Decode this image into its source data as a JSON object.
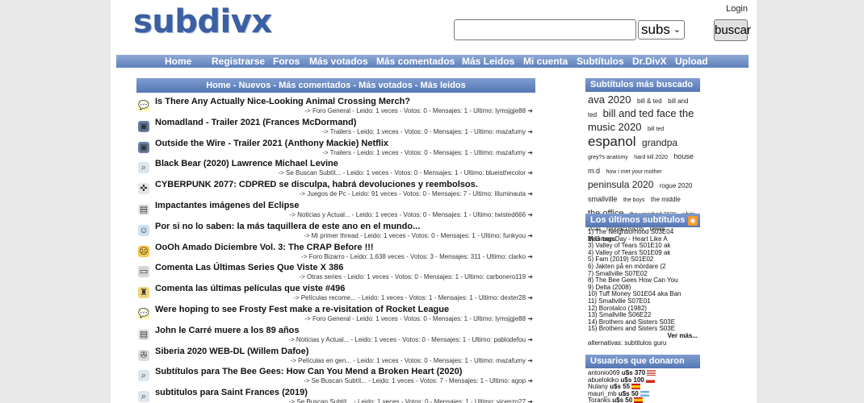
{
  "header": {
    "logo": "subdivx",
    "login": "Login",
    "subs_select": "subs",
    "search_button": "buscar"
  },
  "nav": [
    "Home",
    "Registrarse",
    "Foros",
    "Más votados",
    "Más comentados",
    "Más Leidos",
    "Mi cuenta",
    "Subtítulos",
    "Dr.DivX",
    "Upload"
  ],
  "main": {
    "heading": "Home - Nuevos - Más comentados - Más votados - Más leidos",
    "rows": [
      {
        "icon": "speech-bubble-icon",
        "title": "Is There Any Actually Nice-Looking Animal Crossing Merch?",
        "meta": "-> Foro General - Leido: 1 veces - Votos: 0 - Mensajes: 1 - Ultimo: lymsjgje88"
      },
      {
        "icon": "floppy-disk-icon",
        "title": "Nomadland - Trailer 2021 (Frances McDormand)",
        "meta": "-> Trailers - Leido: 1 veces - Votos: 0 - Mensajes: 1 - Ultimo: mazafumy"
      },
      {
        "icon": "floppy-disk-icon",
        "title": "Outside the Wire - Trailer 2021 (Anthony Mackie) Netflix",
        "meta": "-> Trailers - Leido: 1 veces - Votos: 0 - Mensajes: 1 - Ultimo: mazafumy"
      },
      {
        "icon": "magnifier-icon",
        "title": "Black Bear (2020) Lawrence Michael Levine",
        "meta": "-> Se Buscan Subtít... - Leido: 1 veces - Votos: 0 - Mensajes: 1 - Ultimo: blueisthecolor"
      },
      {
        "icon": "joystick-icon",
        "title": "CYBERPUNK 2077: CDPRED se disculpa, habrá devoluciones y reembolsos.",
        "meta": "-> Juegos de Pc - Leido: 91 veces - Votos: 0 - Mensajes: 7 - Ultimo: Illuminauta"
      },
      {
        "icon": "news-icon",
        "title": "Impactantes imágenes del Eclipse",
        "meta": "-> Noticias y Actual... - Leido: 1 veces - Votos: 0 - Mensajes: 1 - Ultimo: twisted666"
      },
      {
        "icon": "user-icon",
        "title": "Por si no lo saben: la más taquillera de este ano en el mundo...",
        "meta": "-> Mi primer thread - Leido: 1 veces - Votos: 0 - Mensajes: 1 - Ultimo: funkyou"
      },
      {
        "icon": "smiley-icon",
        "title": "OoOh Amado Diciembre Vol. 3: The CRAP Before !!!",
        "meta": "-> Foro Bizarro - Leido: 1,638 veces - Votos: 3 - Mensajes: 311 - Ultimo: clarko"
      },
      {
        "icon": "tv-icon",
        "title": "Comenta Las Últimas Series Que Viste X 386",
        "meta": "-> Otras series - Leido: 1 veces - Votos: 0 - Mensajes: 1 - Ultimo: carbonero119"
      },
      {
        "icon": "oscar-icon",
        "title": "Comenta las últimas películas que viste #496",
        "meta": "-> Películas recome... - Leido: 1 veces - Votos: 1 - Mensajes: 1 - Ultimo: dexter28"
      },
      {
        "icon": "speech-bubble-icon",
        "title": "Were hoping to see Frosty Fest make a re-visitation of Rocket League",
        "meta": "-> Foro General - Leido: 1 veces - Votos: 0 - Mensajes: 1 - Ultimo: lymsjgje88"
      },
      {
        "icon": "news-icon",
        "title": "John le Carré muere a los 89 años",
        "meta": "-> Noticias y Actual... - Leido: 1 veces - Votos: 0 - Mensajes: 1 - Ultimo: pablodefou"
      },
      {
        "icon": "film-reel-icon",
        "title": "Siberia 2020 WEB-DL (Willem Dafoe)",
        "meta": "-> Películas en gen... - Leido: 1 veces - Votos: 0 - Mensajes: 1 - Ultimo: mazafumy"
      },
      {
        "icon": "magnifier-icon",
        "title": "Subtítulos para The Bee Gees: How Can You Mend a Broken Heart (2020)",
        "meta": "-> Se Buscan Subtít... - Leido: 1 veces - Votos: 7 - Mensajes: 1 - Ultimo: agop"
      },
      {
        "icon": "magnifier-icon",
        "title": "subtitulos para Saint Frances (2019)",
        "meta": "-> Se Buscan Subtít... - Leido: 1 veces - Votos: 0 - Mensajes: 1 - Ultimo: vicenzo27"
      }
    ]
  },
  "sidebar": {
    "tags_title": "Subtítulos más buscado",
    "tags": [
      {
        "t": "ava 2020",
        "s": 13
      },
      {
        "t": "bill & ted",
        "s": 8
      },
      {
        "t": "bill and ted",
        "s": 8
      },
      {
        "t": "bill and ted face the music 2020",
        "s": 13
      },
      {
        "t": "bill ted",
        "s": 7
      },
      {
        "t": "espanol",
        "s": 17
      },
      {
        "t": "grandpa",
        "s": 12
      },
      {
        "t": "grey?s anatomy",
        "s": 7
      },
      {
        "t": "hard kill 2020",
        "s": 7
      },
      {
        "t": "house m.d",
        "s": 9
      },
      {
        "t": "how i met your mother",
        "s": 7
      },
      {
        "t": "peninsula 2020",
        "s": 12
      },
      {
        "t": "rogue 2020",
        "s": 8
      },
      {
        "t": "smallville",
        "s": 9
      },
      {
        "t": "the boys",
        "s": 7
      },
      {
        "t": "the middle",
        "s": 8
      },
      {
        "t": "the office",
        "s": 11
      },
      {
        "t": "the vanished 2020",
        "s": 7
      },
      {
        "t": "white",
        "s": 7
      },
      {
        "t": "2020",
        "s": 7
      },
      {
        "t": "hipoacúsicos",
        "s": 8
      },
      {
        "t": "news",
        "s": 8
      },
      {
        "t": "-",
        "s": 8
      }
    ],
    "more_tags": "Más tags",
    "latest_title": "Los últimos subtítulos",
    "latest": [
      "1) The Neighborhood S03E04",
      "2) Green Day - Heart Like A",
      "3) Valley of Tears S01E10 ak",
      "4) Valley of Tears S01E09 ak",
      "5) Fam (2019) S01E02",
      "6) Jakten på en mördare (2",
      "7) Smallville S07E02",
      "8) The Bee Gees How Can You",
      "9) Delta (2008)",
      "10) Tuff Money S01E04 aka Ban",
      "11) Smallville S07E01",
      "12) Borotalco (1982)",
      "13) Smallville S06E22",
      "14) Brothers and Sisters S03E",
      "15) Brothers and Sisters S03E"
    ],
    "ver_mas": "Ver más...",
    "alternativas": "alternativas: subtitulos guru",
    "donors_title": "Usuarios que donaron",
    "donors": [
      {
        "user": "antonio069",
        "amount": "u$s 370",
        "flag": "us"
      },
      {
        "user": "abuelokiko",
        "amount": "u$s 100",
        "flag": "cl"
      },
      {
        "user": "Nulany",
        "amount": "u$s 55",
        "flag": "es"
      },
      {
        "user": "mauri_mb",
        "amount": "u$s 50",
        "flag": "ar"
      },
      {
        "user": "Toranks",
        "amount": "u$s 50",
        "flag": "es"
      }
    ]
  },
  "colors": {
    "brand": "#3b5fa3",
    "nav": "#5c7fbd",
    "rss": "#f39a2b"
  }
}
